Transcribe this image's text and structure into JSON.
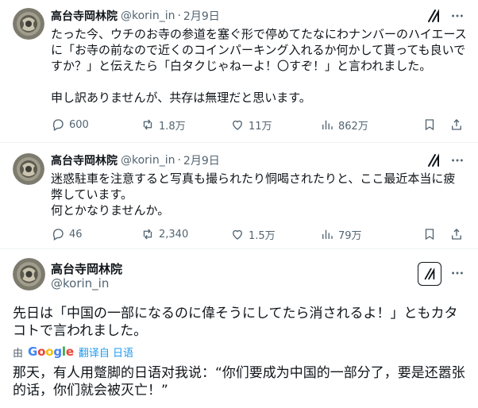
{
  "tweets": [
    {
      "name": "高台寺岡林院",
      "handle": "@korin_in",
      "separator": "·",
      "date": "2月9日",
      "body": [
        "たった今、ウチのお寺の参道を塞ぐ形で停めてたなにわナンバーのハイエースに「お寺の前なので近くのコインパーキング入れるか何かして貰っても良いですか？」と伝えたら「白タクじゃねーよ！〇すぞ！」と言われました。",
        "申し訳ありませんが、共存は無理だと思います。"
      ],
      "stats": {
        "replies": "600",
        "reposts": "1.8万",
        "likes": "11万",
        "views": "862万"
      }
    },
    {
      "name": "高台寺岡林院",
      "handle": "@korin_in",
      "separator": "·",
      "date": "2月9日",
      "body": [
        "迷惑駐車を注意すると写真も撮られたり恫喝されたりと、ここ最近本当に疲弊しています。",
        "何とかなりませんか。"
      ],
      "stats": {
        "replies": "46",
        "reposts": "2,340",
        "likes": "1.5万",
        "views": "79万"
      }
    },
    {
      "name": "高台寺岡林院",
      "handle": "@korin_in",
      "body": "先日は「中国の一部になるのに偉そうにしてたら消されるよ！」ともカタコトで言われました。",
      "translate": {
        "by": "由",
        "provider": "Google",
        "link": "翻译自 日语"
      },
      "translation": "那天，有人用蹩脚的日语对我说：“你们要成为中国的一部分了，要是还嚣张的话，你们就会被灭亡！”"
    }
  ],
  "icons": {
    "reply": "reply-icon",
    "repost": "repost-icon",
    "like": "like-icon",
    "views": "views-icon",
    "bookmark": "bookmark-icon",
    "share": "share-icon",
    "grok": "grok-icon",
    "more": "more-icon"
  },
  "colors": {
    "text": "#0f1419",
    "secondary": "#536471",
    "link": "#1d9bf0",
    "divider": "#eff3f4"
  }
}
